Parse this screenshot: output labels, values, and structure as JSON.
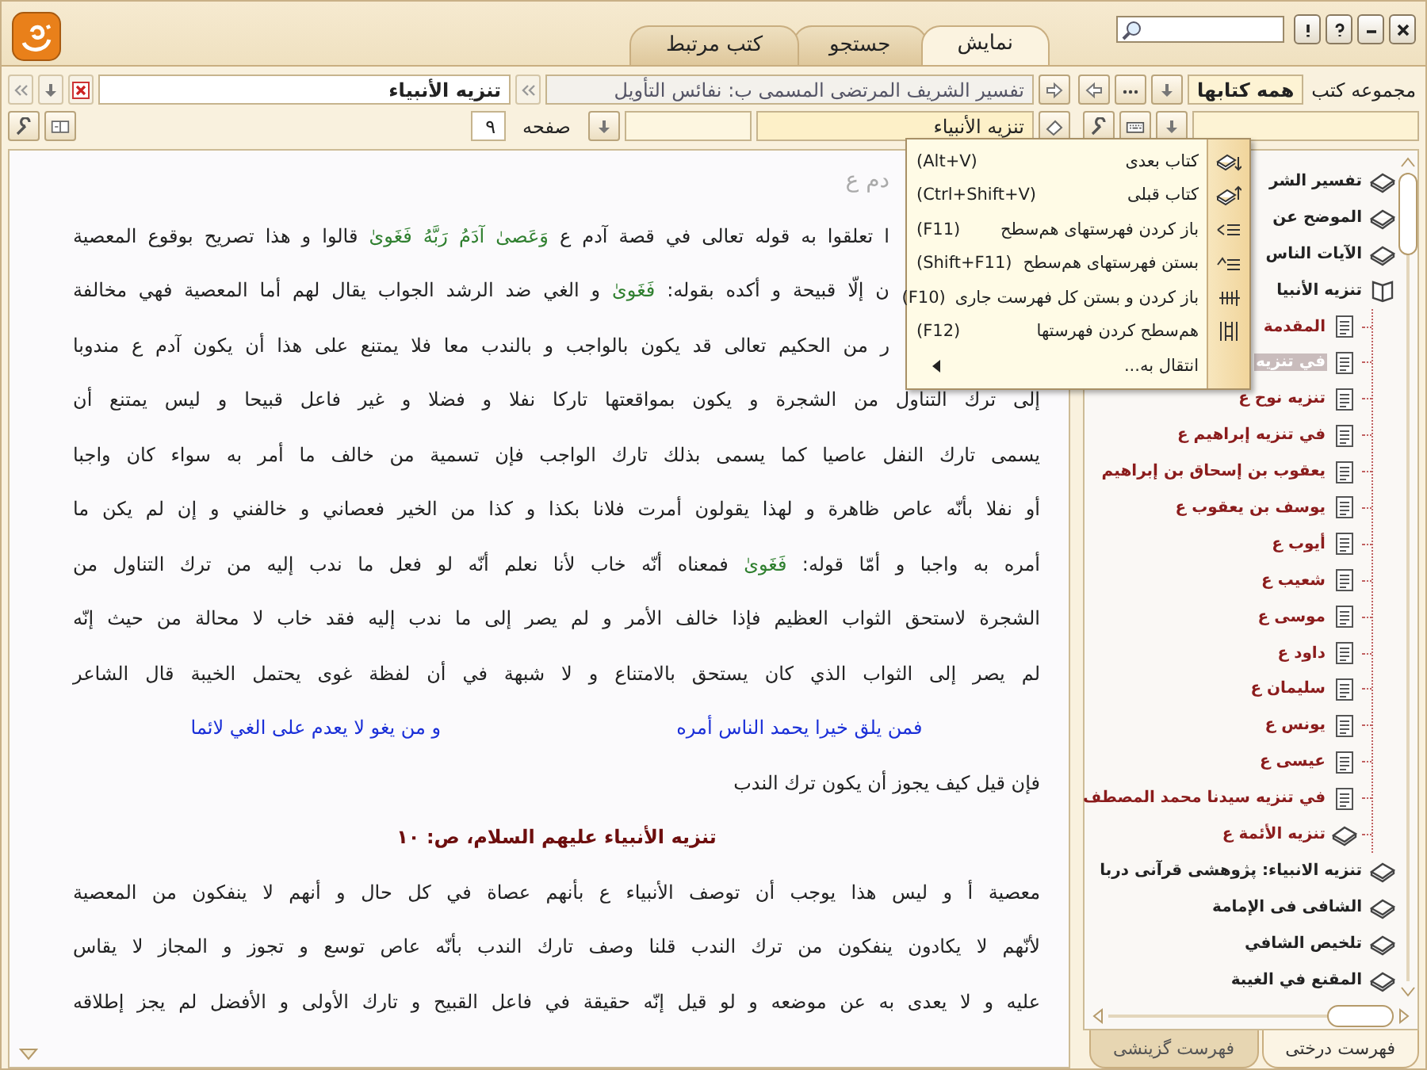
{
  "tabs": [
    {
      "label": "نمایش",
      "selected": true
    },
    {
      "label": "جستجو",
      "selected": false
    },
    {
      "label": "کتب مرتبط",
      "selected": false
    }
  ],
  "sidebar": {
    "collection_label": "مجموعه کتب",
    "collection_value": "همه کتابها",
    "tree": [
      {
        "label": "تفسير الشر",
        "kind": "book",
        "expanded": false,
        "selected": false
      },
      {
        "label": "الموضح عن",
        "kind": "book",
        "expanded": false,
        "selected": false
      },
      {
        "label": "الآيات الناس",
        "kind": "book",
        "expanded": false,
        "selected": false
      },
      {
        "label": "تنزيه الأنبيا",
        "kind": "book",
        "expanded": true,
        "selected": false,
        "children": [
          {
            "label": "المقدمة",
            "kind": "page",
            "selected": false
          },
          {
            "label": "في تنزيه",
            "kind": "page",
            "selected": true
          },
          {
            "label": "تنزيه نوح ع",
            "kind": "page",
            "selected": false
          },
          {
            "label": "في تنزيه إبراهيم ع",
            "kind": "page",
            "selected": false
          },
          {
            "label": "يعقوب بن إسحاق بن إبراهيم",
            "kind": "page",
            "selected": false
          },
          {
            "label": "يوسف بن يعقوب ع",
            "kind": "page",
            "selected": false
          },
          {
            "label": "أيوب ع",
            "kind": "page",
            "selected": false
          },
          {
            "label": "شعيب ع",
            "kind": "page",
            "selected": false
          },
          {
            "label": "موسى ع",
            "kind": "page",
            "selected": false
          },
          {
            "label": "داود ع",
            "kind": "page",
            "selected": false
          },
          {
            "label": "سليمان ع",
            "kind": "page",
            "selected": false
          },
          {
            "label": "يونس ع",
            "kind": "page",
            "selected": false
          },
          {
            "label": "عيسى ع",
            "kind": "page",
            "selected": false
          },
          {
            "label": "في تنزيه سيدنا محمد المصطف",
            "kind": "page",
            "selected": false
          },
          {
            "label": "تنزيه الأئمة ع",
            "kind": "book",
            "selected": false
          }
        ]
      },
      {
        "label": "تنزيه الانبياء: پژوهشی قرآنی دربا",
        "kind": "book",
        "expanded": false,
        "selected": false
      },
      {
        "label": "الشافی فی الإمامة",
        "kind": "book",
        "expanded": false,
        "selected": false
      },
      {
        "label": "تلخيص الشافي",
        "kind": "book",
        "expanded": false,
        "selected": false
      },
      {
        "label": "المقنع في الغيبة",
        "kind": "book",
        "expanded": false,
        "selected": false
      }
    ],
    "bottom_tabs": [
      {
        "label": "فهرست درختی",
        "selected": true
      },
      {
        "label": "فهرست گزینشی",
        "selected": false
      }
    ]
  },
  "reader": {
    "book_title": "تفسير الشريف المرتضى المسمى ب: نفائس التأويل",
    "book_name": "تنزيه الأنبياء",
    "toc_value": "تنزيه الأنبياء",
    "page_label": "صفحه",
    "page_value": "۹",
    "lines": [
      {
        "kind": "chapter-title",
        "parts": [
          {
            "kind": "plain",
            "text": "دم ع"
          }
        ]
      },
      {
        "kind": "text-covered",
        "parts": [
          {
            "kind": "plain",
            "text": "ا تعلقوا به قوله تعالى في قصة آدم ع "
          },
          {
            "kind": "quran",
            "text": "وَعَصىٰ آدَمُ رَبَّهُ فَغَوىٰ"
          },
          {
            "kind": "plain",
            "text": " قالوا و هذا تصريح بوقوع المعصية"
          }
        ]
      },
      {
        "kind": "text-covered",
        "parts": [
          {
            "kind": "plain",
            "text": "ن إلّا قبيحة و أكده بقوله: "
          },
          {
            "kind": "quran",
            "text": "فَغَوىٰ"
          },
          {
            "kind": "plain",
            "text": " و الغي ضد الرشد الجواب يقال لهم أما المعصية فهي مخالفة"
          }
        ]
      },
      {
        "kind": "text-covered",
        "parts": [
          {
            "kind": "plain",
            "text": "ر من الحكيم تعالى قد يكون بالواجب و بالندب معا فلا يمتنع على هذا أن يكون آدم ع مندوبا"
          }
        ]
      },
      {
        "kind": "text",
        "parts": [
          {
            "kind": "plain",
            "text": "إلى ترك التناول من الشجرة و يكون بمواقعتها تاركا نفلا و فضلا و غير فاعل قبيحا و ليس يمتنع أن"
          }
        ]
      },
      {
        "kind": "text",
        "parts": [
          {
            "kind": "plain",
            "text": "يسمى تارك النفل عاصيا كما يسمى بذلك تارك الواجب فإن تسمية من خالف ما أمر به سواء كان واجبا"
          }
        ]
      },
      {
        "kind": "text",
        "parts": [
          {
            "kind": "plain",
            "text": "أو نفلا بأنّه عاص ظاهرة و لهذا يقولون أمرت فلانا بكذا و كذا من الخير فعصاني و خالفني و إن لم يكن ما"
          }
        ]
      },
      {
        "kind": "text",
        "parts": [
          {
            "kind": "plain",
            "text": "أمره به واجبا و أمّا قوله: "
          },
          {
            "kind": "quran",
            "text": "فَغَوىٰ"
          },
          {
            "kind": "plain",
            "text": " فمعناه أنّه خاب لأنا نعلم أنّه لو فعل ما ندب إليه من ترك التناول من"
          }
        ]
      },
      {
        "kind": "text",
        "parts": [
          {
            "kind": "plain",
            "text": "الشجرة لاستحق الثواب العظيم فإذا خالف الأمر و لم يصر إلى ما ندب إليه فقد خاب لا محالة من حيث إنّه"
          }
        ]
      },
      {
        "kind": "text",
        "parts": [
          {
            "kind": "plain",
            "text": "لم يصر إلى الثواب الذي كان يستحق بالامتناع و لا شبهة في أن لفظة غوى يحتمل الخيبة قال الشاعر"
          }
        ]
      },
      {
        "kind": "poem",
        "parts": [
          {
            "kind": "hemistich",
            "text": "فمن يلق خيرا يحمد الناس أمره"
          },
          {
            "kind": "hemistich",
            "text": "و من يغو لا يعدم على الغي لائما"
          }
        ]
      },
      {
        "kind": "text-end",
        "parts": [
          {
            "kind": "plain",
            "text": "فإن قيل كيف يجوز أن يكون ترك الندب"
          }
        ]
      },
      {
        "kind": "page-title",
        "parts": [
          {
            "kind": "plain",
            "text": "تنزيه الأنبياء عليهم السلام، ص: ۱۰"
          }
        ]
      },
      {
        "kind": "text",
        "parts": [
          {
            "kind": "plain",
            "text": "معصية أ و ليس هذا يوجب أن توصف الأنبياء ع بأنهم عصاة في كل حال و أنهم لا ينفكون من المعصية"
          }
        ]
      },
      {
        "kind": "text",
        "parts": [
          {
            "kind": "plain",
            "text": "لأنّهم لا يكادون ينفكون من ترك الندب قلنا وصف تارك الندب بأنّه عاص توسع و تجوز و المجاز لا يقاس"
          }
        ]
      },
      {
        "kind": "text",
        "parts": [
          {
            "kind": "plain",
            "text": "عليه و لا يعدى به عن موضعه و لو قيل إنّه حقيقة في فاعل القبيح و تارك الأولى و الأفضل لم يجز إطلاقه"
          }
        ]
      }
    ]
  },
  "menu": {
    "items": [
      {
        "kind": "next-book",
        "label": "کتاب بعدی",
        "shortcut": "(Alt+V)"
      },
      {
        "kind": "prev-book",
        "label": "کتاب قبلی",
        "shortcut": "(Ctrl+Shift+V)"
      },
      {
        "kind": "expand-level",
        "label": "باز کردن فهرستهای هم‌سطح",
        "shortcut": "(F11)"
      },
      {
        "kind": "collapse-level",
        "label": "بستن فهرستهای هم‌سطح",
        "shortcut": "(Shift+F11)"
      },
      {
        "kind": "expand-all",
        "label": "باز کردن و بستن کل فهرست جاری",
        "shortcut": "(F10)"
      },
      {
        "kind": "align-levels",
        "label": "هم‌سطح کردن فهرستها",
        "shortcut": "(F12)"
      },
      {
        "kind": "submenu",
        "label": "انتقال به..."
      }
    ]
  }
}
